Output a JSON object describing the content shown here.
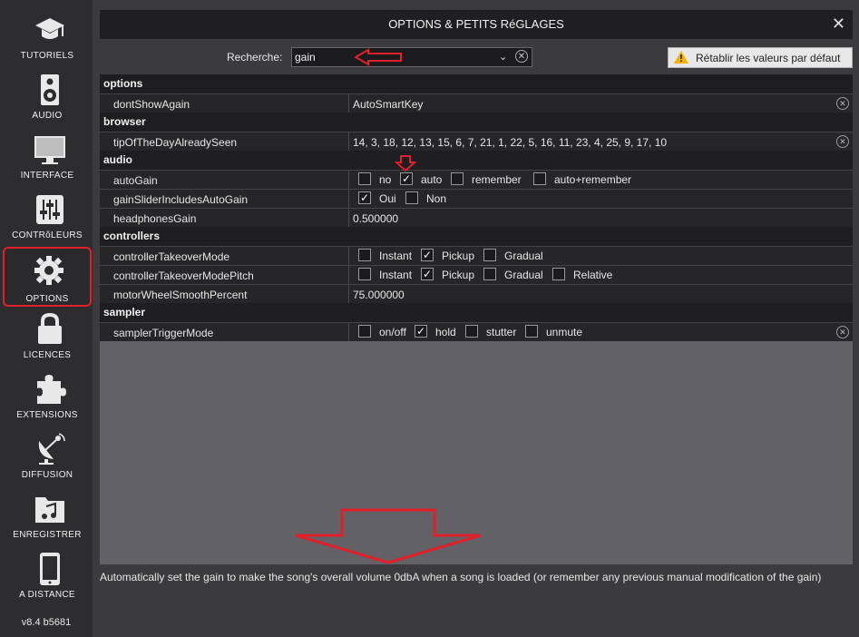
{
  "sidebar": {
    "items": [
      {
        "label": "TUTORIELS",
        "icon": "graduation-cap-icon"
      },
      {
        "label": "AUDIO",
        "icon": "speaker-icon"
      },
      {
        "label": "INTERFACE",
        "icon": "monitor-icon"
      },
      {
        "label": "CONTRôLEURS",
        "icon": "sliders-icon"
      },
      {
        "label": "OPTIONS",
        "icon": "gear-icon"
      },
      {
        "label": "LICENCES",
        "icon": "lock-icon"
      },
      {
        "label": "EXTENSIONS",
        "icon": "puzzle-icon"
      },
      {
        "label": "DIFFUSION",
        "icon": "satellite-dish-icon"
      },
      {
        "label": "ENREGISTRER",
        "icon": "music-folder-icon"
      },
      {
        "label": "A DISTANCE",
        "icon": "tablet-icon"
      }
    ],
    "active": "OPTIONS",
    "version": "v8.4 b5681"
  },
  "header": {
    "title": "OPTIONS & PETITS RéGLAGES",
    "close": "✕"
  },
  "search": {
    "label": "Recherche:",
    "value": "gain"
  },
  "reset": {
    "label": "Rétablir les valeurs par défaut"
  },
  "sections": {
    "options": {
      "name": "options",
      "dontShowAgain": {
        "name": "dontShowAgain",
        "value": "AutoSmartKey"
      }
    },
    "browser": {
      "name": "browser",
      "tipOfTheDayAlreadySeen": {
        "name": "tipOfTheDayAlreadySeen",
        "value": "14, 3, 18, 12, 13, 15, 6, 7, 21, 1, 22, 5, 16, 11, 23, 4, 25, 9, 17, 10"
      }
    },
    "audio": {
      "name": "audio",
      "autoGain": {
        "name": "autoGain",
        "options": [
          "no",
          "auto",
          "remember",
          "auto+remember"
        ],
        "checked": "auto"
      },
      "gainSliderIncludesAutoGain": {
        "name": "gainSliderIncludesAutoGain",
        "options": [
          "Oui",
          "Non"
        ],
        "checked": "Oui"
      },
      "headphonesGain": {
        "name": "headphonesGain",
        "value": "0.500000"
      }
    },
    "controllers": {
      "name": "controllers",
      "controllerTakeoverMode": {
        "name": "controllerTakeoverMode",
        "options": [
          "Instant",
          "Pickup",
          "Gradual"
        ],
        "checked": "Pickup"
      },
      "controllerTakeoverModePitch": {
        "name": "controllerTakeoverModePitch",
        "options": [
          "Instant",
          "Pickup",
          "Gradual",
          "Relative"
        ],
        "checked": "Pickup"
      },
      "motorWheelSmoothPercent": {
        "name": "motorWheelSmoothPercent",
        "value": "75.000000"
      }
    },
    "sampler": {
      "name": "sampler",
      "samplerTriggerMode": {
        "name": "samplerTriggerMode",
        "options": [
          "on/off",
          "hold",
          "stutter",
          "unmute"
        ],
        "checked": "hold"
      }
    }
  },
  "hint": "Automatically set the gain to make the song's overall volume 0dbA when a song is loaded (or remember any previous manual modification of the gain)",
  "colors": {
    "accent_red": "#e0202a",
    "background": "#3b3b3d",
    "table_empty": "#616166"
  }
}
